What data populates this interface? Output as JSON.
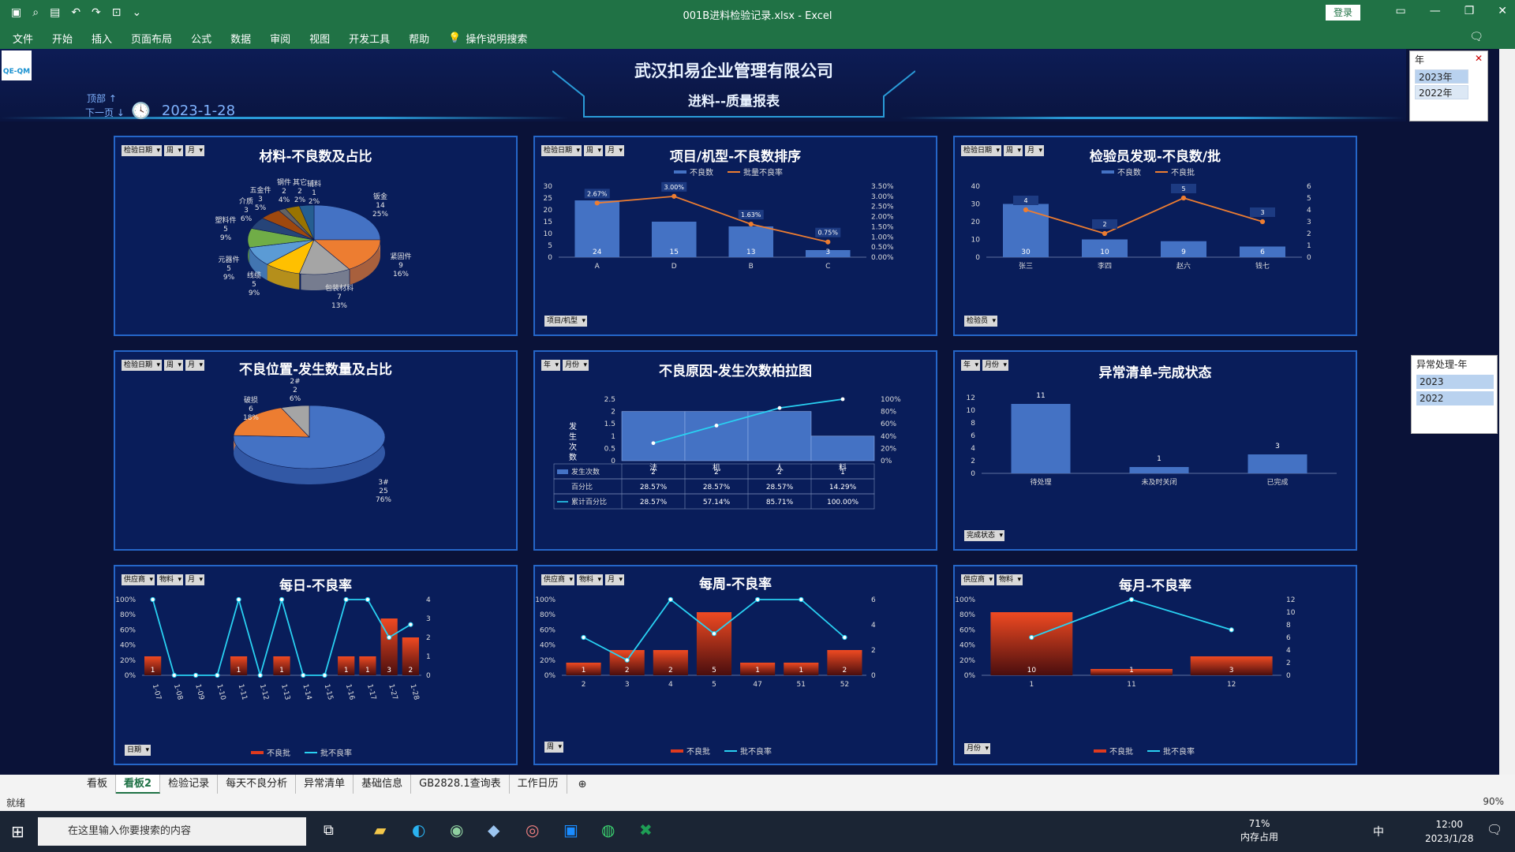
{
  "window": {
    "title": "001B进料检验记录.xlsx  -  Excel",
    "login": "登录"
  },
  "ribbon": {
    "tabs": [
      "文件",
      "开始",
      "插入",
      "页面布局",
      "公式",
      "数据",
      "审阅",
      "视图",
      "开发工具",
      "帮助"
    ],
    "tell": "操作说明搜索"
  },
  "header": {
    "company": "武汉扣易企业管理有限公司",
    "report": "进料--质量报表",
    "nav_top": "顶部 ↑",
    "nav_next": "下一页 ↓",
    "date": "2023-1-28",
    "logo": "QE-QM"
  },
  "slicer_year": {
    "title": "年",
    "items": [
      "2023年",
      "2022年"
    ]
  },
  "slicer_exception": {
    "title": "异常处理-年",
    "items": [
      "2023",
      "2022"
    ]
  },
  "panels": {
    "p1": {
      "title": "材料-不良数及占比",
      "ctrls": [
        "检验日期",
        "周",
        "月"
      ]
    },
    "p2": {
      "title": "项目/机型-不良数排序",
      "ctrls": [
        "检验日期",
        "周",
        "月"
      ],
      "legend": [
        "不良数",
        "批量不良率"
      ],
      "filter": "项目/机型"
    },
    "p3": {
      "title": "检验员发现-不良数/批",
      "ctrls": [
        "检验日期",
        "周",
        "月"
      ],
      "legend": [
        "不良数",
        "不良批"
      ],
      "filter": "检验员"
    },
    "p4": {
      "title": "不良位置-发生数量及占比",
      "ctrls": [
        "检验日期",
        "周",
        "月"
      ]
    },
    "p5": {
      "title": "不良原因-发生次数柏拉图",
      "ctrls": [
        "年",
        "月份"
      ],
      "ylabel": "发生次数",
      "rows": [
        "发生次数",
        "百分比",
        "累计百分比"
      ]
    },
    "p6": {
      "title": "异常清单-完成状态",
      "ctrls": [
        "年",
        "月份"
      ],
      "filter": "完成状态"
    },
    "p7": {
      "title": "每日-不良率",
      "ctrls": [
        "供应商",
        "物料",
        "月"
      ],
      "legend": [
        "不良批",
        "批不良率"
      ],
      "filter": "日期"
    },
    "p8": {
      "title": "每周-不良率",
      "ctrls": [
        "供应商",
        "物料",
        "月"
      ],
      "legend": [
        "不良批",
        "批不良率"
      ],
      "filter": "周"
    },
    "p9": {
      "title": "每月-不良率",
      "ctrls": [
        "供应商",
        "物料"
      ],
      "legend": [
        "不良批",
        "批不良率"
      ],
      "filter": "月份"
    }
  },
  "chart_data": [
    {
      "type": "pie",
      "title": "材料-不良数及占比",
      "labels": [
        "钣金",
        "紧固件",
        "包装材料",
        "线缆",
        "元器件",
        "塑料件",
        "介质",
        "五金件",
        "辅料",
        "钢件",
        "其它"
      ],
      "values": [
        14,
        9,
        7,
        5,
        5,
        5,
        3,
        3,
        1,
        2,
        2
      ],
      "percent": [
        "25%",
        "16%",
        "13%",
        "9%",
        "9%",
        "9%",
        "6%",
        "5%",
        "2%",
        "4%",
        "2%"
      ]
    },
    {
      "type": "bar",
      "title": "项目/机型-不良数排序",
      "categories": [
        "A",
        "D",
        "B",
        "C"
      ],
      "series": [
        {
          "name": "不良数",
          "values": [
            24,
            15,
            13,
            3
          ]
        },
        {
          "name": "批量不良率",
          "values": [
            2.67,
            3.0,
            1.63,
            0.75
          ],
          "labels": [
            "2.67%",
            "3.00%",
            "1.63%",
            "0.75%"
          ]
        }
      ],
      "ylim": [
        0,
        30
      ],
      "y2lim": [
        0,
        3.5
      ],
      "yticks": [
        0,
        5,
        10,
        15,
        20,
        25,
        30
      ],
      "y2ticks": [
        "0.00%",
        "0.50%",
        "1.00%",
        "1.50%",
        "2.00%",
        "2.50%",
        "3.00%",
        "3.50%"
      ]
    },
    {
      "type": "bar",
      "title": "检验员发现-不良数/批",
      "categories": [
        "张三",
        "李四",
        "赵六",
        "钱七"
      ],
      "series": [
        {
          "name": "不良数",
          "values": [
            30,
            10,
            9,
            6
          ]
        },
        {
          "name": "不良批",
          "values": [
            4,
            2,
            5,
            3
          ]
        }
      ],
      "ylim": [
        0,
        40
      ],
      "y2lim": [
        0,
        6
      ],
      "yticks": [
        0,
        10,
        20,
        30,
        40
      ],
      "y2ticks": [
        0,
        1,
        2,
        3,
        4,
        5,
        6
      ]
    },
    {
      "type": "pie",
      "title": "不良位置-发生数量及占比",
      "labels": [
        "3#",
        "破损",
        "2#"
      ],
      "values": [
        25,
        6,
        2
      ],
      "percent": [
        "76%",
        "18%",
        "6%"
      ]
    },
    {
      "type": "bar",
      "title": "不良原因-发生次数柏拉图",
      "categories": [
        "法",
        "机",
        "人",
        "料"
      ],
      "series": [
        {
          "name": "发生次数",
          "values": [
            2,
            2,
            2,
            1
          ]
        },
        {
          "name": "百分比",
          "values": [
            "28.57%",
            "28.57%",
            "28.57%",
            "14.29%"
          ]
        },
        {
          "name": "累计百分比",
          "values": [
            28.57,
            57.14,
            85.71,
            100.0
          ],
          "labels": [
            "28.57%",
            "57.14%",
            "85.71%",
            "100.00%"
          ]
        }
      ],
      "ylim": [
        0,
        2.5
      ],
      "yticks": [
        "0",
        "0.5",
        "1",
        "1.5",
        "2",
        "2.5"
      ],
      "y2ticks": [
        "0%",
        "20%",
        "40%",
        "60%",
        "80%",
        "100%"
      ]
    },
    {
      "type": "bar",
      "title": "异常清单-完成状态",
      "categories": [
        "待处理",
        "未及时关闭",
        "已完成"
      ],
      "values": [
        11,
        1,
        3
      ],
      "ylim": [
        0,
        12
      ],
      "yticks": [
        0,
        2,
        4,
        6,
        8,
        10,
        12
      ]
    },
    {
      "type": "bar",
      "title": "每日-不良率",
      "categories": [
        "1-07",
        "1-08",
        "1-09",
        "1-10",
        "1-11",
        "1-12",
        "1-13",
        "1-14",
        "1-15",
        "1-16",
        "1-17",
        "1-27",
        "1-28"
      ],
      "series": [
        {
          "name": "不良批",
          "values": [
            1,
            0,
            0,
            0,
            1,
            0,
            1,
            0,
            0,
            1,
            1,
            3,
            2
          ],
          "labels": [
            "1",
            "",
            "",
            "",
            "1",
            "",
            "1",
            "",
            "",
            "1",
            "1",
            "3",
            "2"
          ]
        },
        {
          "name": "批不良率",
          "values": [
            100,
            0,
            0,
            0,
            100,
            0,
            100,
            0,
            0,
            100,
            100,
            50,
            67
          ]
        }
      ],
      "yticks": [
        "0%",
        "20%",
        "40%",
        "60%",
        "80%",
        "100%"
      ],
      "y2ticks": [
        0,
        1,
        2,
        3,
        4
      ]
    },
    {
      "type": "bar",
      "title": "每周-不良率",
      "categories": [
        "2",
        "3",
        "4",
        "5",
        "47",
        "51",
        "52"
      ],
      "series": [
        {
          "name": "不良批",
          "values": [
            1,
            2,
            2,
            5,
            1,
            1,
            2
          ]
        },
        {
          "name": "批不良率",
          "values": [
            50,
            20,
            100,
            55,
            100,
            100,
            50
          ]
        }
      ],
      "yticks": [
        "0%",
        "20%",
        "40%",
        "60%",
        "80%",
        "100%"
      ],
      "y2ticks": [
        0,
        2,
        4,
        6
      ]
    },
    {
      "type": "bar",
      "title": "每月-不良率",
      "categories": [
        "1",
        "11",
        "12"
      ],
      "series": [
        {
          "name": "不良批",
          "values": [
            10,
            1,
            3
          ]
        },
        {
          "name": "批不良率",
          "values": [
            50,
            100,
            60
          ]
        }
      ],
      "yticks": [
        "0%",
        "20%",
        "40%",
        "60%",
        "80%",
        "100%"
      ],
      "y2ticks": [
        0,
        2,
        4,
        6,
        8,
        10,
        12
      ]
    }
  ],
  "sheet_tabs": [
    "看板",
    "看板2",
    "检验记录",
    "每天不良分析",
    "异常清单",
    "基础信息",
    "GB2828.1查询表",
    "工作日历"
  ],
  "status": {
    "ready": "就绪",
    "zoom": "90%"
  },
  "taskbar": {
    "search": "在这里输入你要搜索的内容",
    "mem": "71%",
    "mem_label": "内存占用",
    "time": "12:00",
    "date": "2023/1/28",
    "ime": "中"
  },
  "colors": {
    "bar_blue": "#4472c4",
    "bar_red": "#e03a1e",
    "line_orange": "#ed7d31",
    "line_cyan": "#29d1f2",
    "panel_border": "#2566c8"
  }
}
